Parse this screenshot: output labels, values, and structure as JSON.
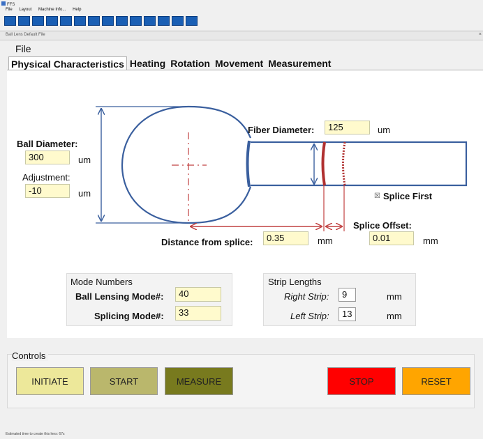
{
  "window": {
    "title": "FFS"
  },
  "system_menu": [
    "File",
    "Layout",
    "Machine Info...",
    "Help"
  ],
  "toolbar_icons": [
    "tool-1-icon",
    "tool-2-icon",
    "tool-3-icon",
    "tool-4-icon",
    "tool-5-icon",
    "tool-6-icon",
    "tool-7-icon",
    "tool-8-icon",
    "tool-9-icon",
    "tool-10-icon",
    "tool-11-icon",
    "tool-12-icon",
    "tool-13-icon",
    "tool-14-icon"
  ],
  "document": {
    "title": "Ball Lens Default File",
    "close_glyph": "×",
    "file_menu": "File"
  },
  "tabs": [
    "Physical Characteristics",
    "Heating",
    "Rotation",
    "Movement",
    "Measurement"
  ],
  "physical": {
    "ball_diameter_label": "Ball Diameter:",
    "ball_diameter_value": "300",
    "ball_diameter_unit": "um",
    "adjustment_label": "Adjustment:",
    "adjustment_value": "-10",
    "adjustment_unit": "um",
    "fiber_diameter_label": "Fiber Diameter:",
    "fiber_diameter_value": "125",
    "fiber_diameter_unit": "um",
    "splice_first_label": "Splice First",
    "splice_first_glyph": "☒",
    "splice_offset_label": "Splice Offset:",
    "splice_offset_value": "0.01",
    "splice_offset_unit": "mm",
    "distance_label": "Distance from splice:",
    "distance_value": "0.35",
    "distance_unit": "mm"
  },
  "mode_numbers": {
    "title": "Mode Numbers",
    "ball_lensing_label": "Ball Lensing Mode#:",
    "ball_lensing_value": "40",
    "splicing_label": "Splicing Mode#:",
    "splicing_value": "33"
  },
  "strip_lengths": {
    "title": "Strip Lengths",
    "right_label": "Right Strip:",
    "right_value": "9",
    "right_unit": "mm",
    "left_label": "Left Strip:",
    "left_value": "13",
    "left_unit": "mm"
  },
  "controls": {
    "title": "Controls",
    "initiate": "INITIATE",
    "start": "START",
    "measure": "MEASURE",
    "stop": "STOP",
    "reset": "RESET"
  },
  "colors": {
    "diagram_blue": "#3a5f9e",
    "splice_red": "#b03030",
    "initiate": "#ede89a",
    "start": "#bab76c",
    "measure": "#787a1e",
    "stop": "#ff0000",
    "reset": "#ffa500"
  },
  "status_bar": "Estimated time to create this lens: 67s"
}
